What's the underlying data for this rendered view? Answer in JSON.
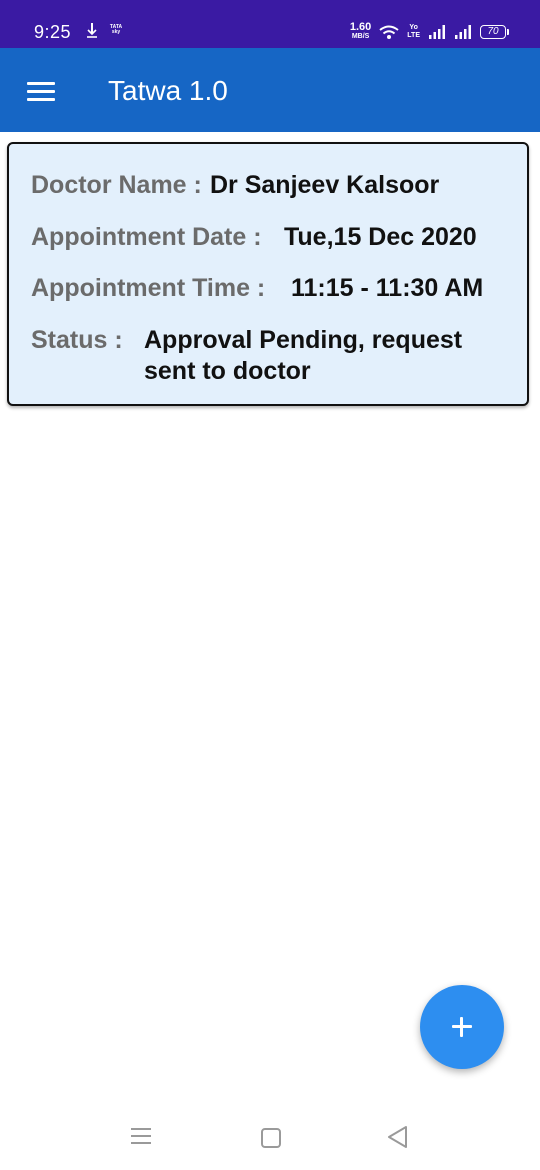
{
  "status_bar": {
    "time": "9:25",
    "carrier_logo_line1": "TATA",
    "carrier_logo_line2": "sky",
    "net_speed_value": "1.60",
    "net_speed_unit": "MB/S",
    "volte_line1": "Yo",
    "volte_line2": "LTE",
    "battery_level": "70",
    "icons": [
      "download-icon",
      "tatasky-logo",
      "wifi-icon",
      "volte-icon",
      "signal-icon",
      "signal-icon",
      "battery-icon"
    ]
  },
  "app_bar": {
    "title": "Tatwa 1.0",
    "menu_icon": "hamburger-menu-icon"
  },
  "appointment": {
    "doctor_label": "Doctor Name :",
    "doctor_value": "Dr Sanjeev Kalsoor",
    "date_label": "Appointment Date :",
    "date_value": "Tue,15 Dec 2020",
    "time_label": "Appointment Time :",
    "time_value": "11:15 - 11:30 AM",
    "status_label": "Status :",
    "status_value_line1": "Approval Pending, request",
    "status_value_line2": "sent to doctor"
  },
  "fab": {
    "icon": "plus-icon",
    "color": "#2d8ef0"
  },
  "nav_bar": {
    "icons": [
      "recent-apps-icon",
      "home-icon",
      "back-icon"
    ]
  },
  "colors": {
    "status_bar": "#3a1aa3",
    "app_bar": "#1666c5",
    "card_background": "#e3f0fc",
    "label_text": "#6b6b6b",
    "value_text": "#111111"
  }
}
